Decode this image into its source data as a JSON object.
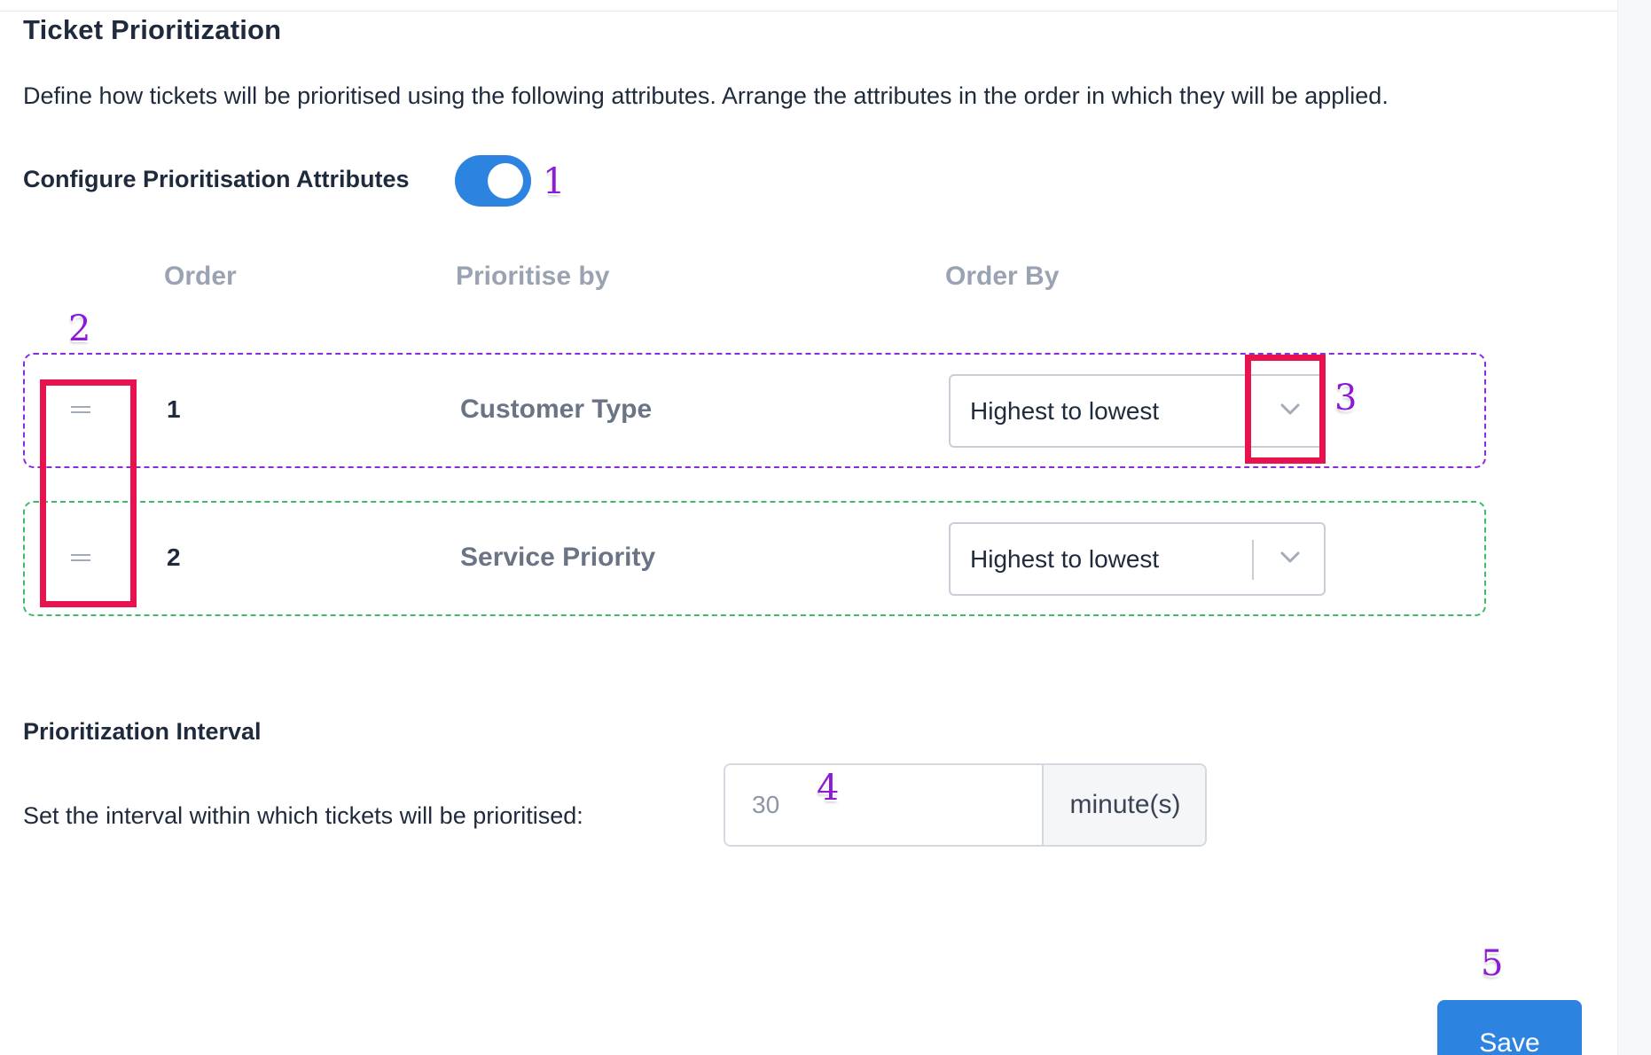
{
  "page": {
    "title": "Ticket Prioritization",
    "description": "Define how tickets will be prioritised using the following attributes. Arrange the attributes in the order in which they will be applied."
  },
  "config": {
    "label": "Configure Prioritisation Attributes",
    "toggle_on": true,
    "accent_color": "#2d84e0"
  },
  "table": {
    "headers": {
      "order": "Order",
      "prioritise_by": "Prioritise by",
      "order_by": "Order By"
    },
    "rows": [
      {
        "order": "1",
        "attribute": "Customer Type",
        "order_by": "Highest to lowest"
      },
      {
        "order": "2",
        "attribute": "Service Priority",
        "order_by": "Highest to lowest"
      }
    ]
  },
  "interval": {
    "title": "Prioritization Interval",
    "label": "Set the interval within which tickets will be prioritised:",
    "placeholder": "30",
    "unit": "minute(s)"
  },
  "actions": {
    "save_label": "Save"
  },
  "annotations": {
    "markers": [
      "1",
      "2",
      "3",
      "4",
      "5"
    ],
    "marker_color": "#8a1cd6",
    "box_color": "#e8124f"
  },
  "icons": {
    "drag_handle": "drag-handle-icon",
    "dropdown": "chevron-down-icon"
  }
}
